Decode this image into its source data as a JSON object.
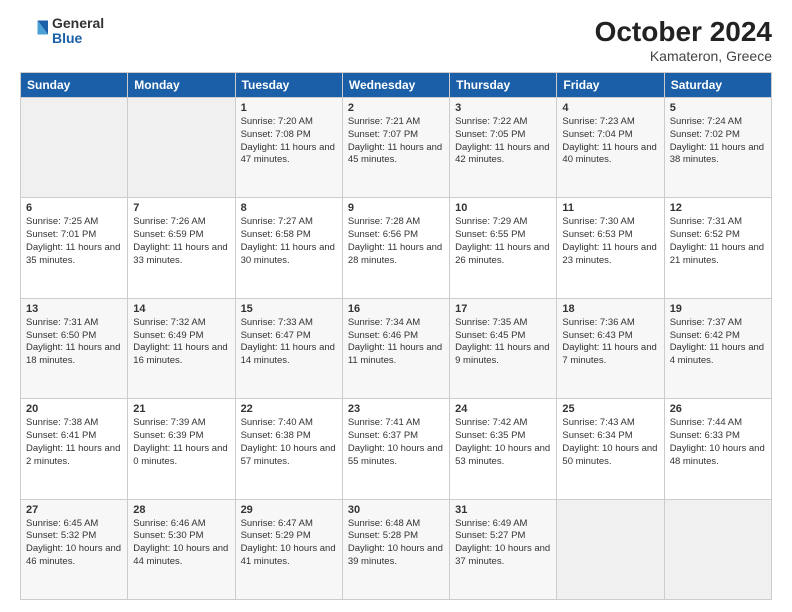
{
  "logo": {
    "general": "General",
    "blue": "Blue"
  },
  "header": {
    "month": "October 2024",
    "location": "Kamateron, Greece"
  },
  "days_of_week": [
    "Sunday",
    "Monday",
    "Tuesday",
    "Wednesday",
    "Thursday",
    "Friday",
    "Saturday"
  ],
  "weeks": [
    [
      {
        "day": "",
        "content": ""
      },
      {
        "day": "",
        "content": ""
      },
      {
        "day": "1",
        "content": "Sunrise: 7:20 AM\nSunset: 7:08 PM\nDaylight: 11 hours and 47 minutes."
      },
      {
        "day": "2",
        "content": "Sunrise: 7:21 AM\nSunset: 7:07 PM\nDaylight: 11 hours and 45 minutes."
      },
      {
        "day": "3",
        "content": "Sunrise: 7:22 AM\nSunset: 7:05 PM\nDaylight: 11 hours and 42 minutes."
      },
      {
        "day": "4",
        "content": "Sunrise: 7:23 AM\nSunset: 7:04 PM\nDaylight: 11 hours and 40 minutes."
      },
      {
        "day": "5",
        "content": "Sunrise: 7:24 AM\nSunset: 7:02 PM\nDaylight: 11 hours and 38 minutes."
      }
    ],
    [
      {
        "day": "6",
        "content": "Sunrise: 7:25 AM\nSunset: 7:01 PM\nDaylight: 11 hours and 35 minutes."
      },
      {
        "day": "7",
        "content": "Sunrise: 7:26 AM\nSunset: 6:59 PM\nDaylight: 11 hours and 33 minutes."
      },
      {
        "day": "8",
        "content": "Sunrise: 7:27 AM\nSunset: 6:58 PM\nDaylight: 11 hours and 30 minutes."
      },
      {
        "day": "9",
        "content": "Sunrise: 7:28 AM\nSunset: 6:56 PM\nDaylight: 11 hours and 28 minutes."
      },
      {
        "day": "10",
        "content": "Sunrise: 7:29 AM\nSunset: 6:55 PM\nDaylight: 11 hours and 26 minutes."
      },
      {
        "day": "11",
        "content": "Sunrise: 7:30 AM\nSunset: 6:53 PM\nDaylight: 11 hours and 23 minutes."
      },
      {
        "day": "12",
        "content": "Sunrise: 7:31 AM\nSunset: 6:52 PM\nDaylight: 11 hours and 21 minutes."
      }
    ],
    [
      {
        "day": "13",
        "content": "Sunrise: 7:31 AM\nSunset: 6:50 PM\nDaylight: 11 hours and 18 minutes."
      },
      {
        "day": "14",
        "content": "Sunrise: 7:32 AM\nSunset: 6:49 PM\nDaylight: 11 hours and 16 minutes."
      },
      {
        "day": "15",
        "content": "Sunrise: 7:33 AM\nSunset: 6:47 PM\nDaylight: 11 hours and 14 minutes."
      },
      {
        "day": "16",
        "content": "Sunrise: 7:34 AM\nSunset: 6:46 PM\nDaylight: 11 hours and 11 minutes."
      },
      {
        "day": "17",
        "content": "Sunrise: 7:35 AM\nSunset: 6:45 PM\nDaylight: 11 hours and 9 minutes."
      },
      {
        "day": "18",
        "content": "Sunrise: 7:36 AM\nSunset: 6:43 PM\nDaylight: 11 hours and 7 minutes."
      },
      {
        "day": "19",
        "content": "Sunrise: 7:37 AM\nSunset: 6:42 PM\nDaylight: 11 hours and 4 minutes."
      }
    ],
    [
      {
        "day": "20",
        "content": "Sunrise: 7:38 AM\nSunset: 6:41 PM\nDaylight: 11 hours and 2 minutes."
      },
      {
        "day": "21",
        "content": "Sunrise: 7:39 AM\nSunset: 6:39 PM\nDaylight: 11 hours and 0 minutes."
      },
      {
        "day": "22",
        "content": "Sunrise: 7:40 AM\nSunset: 6:38 PM\nDaylight: 10 hours and 57 minutes."
      },
      {
        "day": "23",
        "content": "Sunrise: 7:41 AM\nSunset: 6:37 PM\nDaylight: 10 hours and 55 minutes."
      },
      {
        "day": "24",
        "content": "Sunrise: 7:42 AM\nSunset: 6:35 PM\nDaylight: 10 hours and 53 minutes."
      },
      {
        "day": "25",
        "content": "Sunrise: 7:43 AM\nSunset: 6:34 PM\nDaylight: 10 hours and 50 minutes."
      },
      {
        "day": "26",
        "content": "Sunrise: 7:44 AM\nSunset: 6:33 PM\nDaylight: 10 hours and 48 minutes."
      }
    ],
    [
      {
        "day": "27",
        "content": "Sunrise: 6:45 AM\nSunset: 5:32 PM\nDaylight: 10 hours and 46 minutes."
      },
      {
        "day": "28",
        "content": "Sunrise: 6:46 AM\nSunset: 5:30 PM\nDaylight: 10 hours and 44 minutes."
      },
      {
        "day": "29",
        "content": "Sunrise: 6:47 AM\nSunset: 5:29 PM\nDaylight: 10 hours and 41 minutes."
      },
      {
        "day": "30",
        "content": "Sunrise: 6:48 AM\nSunset: 5:28 PM\nDaylight: 10 hours and 39 minutes."
      },
      {
        "day": "31",
        "content": "Sunrise: 6:49 AM\nSunset: 5:27 PM\nDaylight: 10 hours and 37 minutes."
      },
      {
        "day": "",
        "content": ""
      },
      {
        "day": "",
        "content": ""
      }
    ]
  ]
}
